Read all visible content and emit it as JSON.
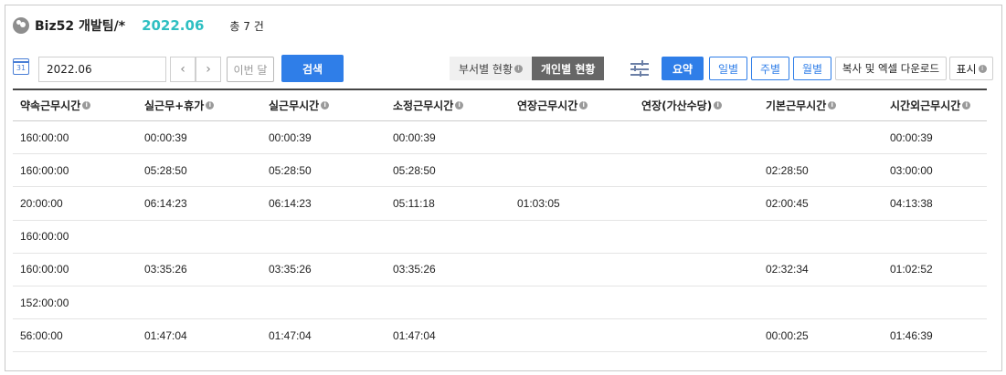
{
  "header": {
    "team_name": "Biz52 개발팀/*",
    "period": "2022.06",
    "total": "총 7 건"
  },
  "toolbar": {
    "calendar_icon_text": "31",
    "month_value": "2022.06",
    "prev": "‹",
    "next": "›",
    "this_month": "이번 달",
    "search": "검색",
    "view_tabs": [
      "부서별 현황",
      "개인별 현황"
    ],
    "active_view": "개인별 현황",
    "period_buttons": [
      "요약",
      "일별",
      "주별",
      "월별"
    ],
    "active_period": "요약",
    "copy_excel": "복사 및 엑셀 다운로드",
    "display": "표시",
    "info_mark": "i"
  },
  "table": {
    "columns": [
      "약속근무시간",
      "실근무+휴가",
      "실근무시간",
      "소정근무시간",
      "연장근무시간",
      "연장(가산수당)",
      "기본근무시간",
      "시간외근무시간"
    ],
    "rows": [
      [
        "160:00:00",
        "00:00:39",
        "00:00:39",
        "00:00:39",
        "",
        "",
        "",
        "00:00:39"
      ],
      [
        "160:00:00",
        "05:28:50",
        "05:28:50",
        "05:28:50",
        "",
        "",
        "02:28:50",
        "03:00:00"
      ],
      [
        "20:00:00",
        "06:14:23",
        "06:14:23",
        "05:11:18",
        "01:03:05",
        "",
        "02:00:45",
        "04:13:38"
      ],
      [
        "160:00:00",
        "",
        "",
        "",
        "",
        "",
        "",
        ""
      ],
      [
        "160:00:00",
        "03:35:26",
        "03:35:26",
        "03:35:26",
        "",
        "",
        "02:32:34",
        "01:02:52"
      ],
      [
        "152:00:00",
        "",
        "",
        "",
        "",
        "",
        "",
        ""
      ],
      [
        "56:00:00",
        "01:47:04",
        "01:47:04",
        "01:47:04",
        "",
        "",
        "00:00:25",
        "01:46:39"
      ]
    ]
  },
  "colors": {
    "accent": "#2f7ee8",
    "period_title": "#2fbfc2",
    "active_tab": "#666666"
  }
}
